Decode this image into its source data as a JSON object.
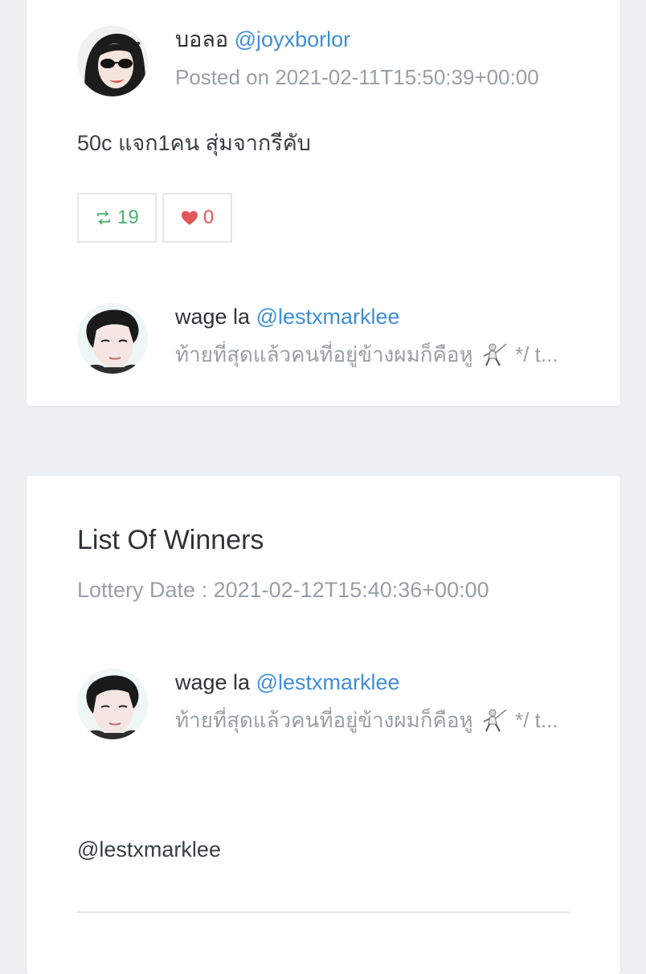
{
  "post": {
    "author": {
      "display_name": "บอลอ",
      "handle": "@joyxborlor",
      "posted_on": "Posted on 2021-02-11T15:50:39+00:00",
      "avatar_icon": "avatar-woman-sunglasses"
    },
    "text": "50c แจก1คน สุ่มจากรีคับ",
    "retweets": "19",
    "likes": "0",
    "retweet_color": "#4caf76",
    "like_color": "#e0575b",
    "participant": {
      "display_name": "wage la",
      "handle": "@lestxmarklee",
      "bio_prefix": "ท้ายที่สุดแล้วคนที่อยู่ข้างผมก็คือหู",
      "bio_suffix": "*/ t...",
      "avatar_icon": "avatar-young-man"
    }
  },
  "winners": {
    "title": "List Of Winners",
    "lottery_date": "Lottery Date : 2021-02-12T15:40:36+00:00",
    "winner": {
      "display_name": "wage la",
      "handle": "@lestxmarklee",
      "bio_prefix": "ท้ายที่สุดแล้วคนที่อยู่ข้างผมก็คือหู",
      "bio_suffix": "*/ t...",
      "avatar_icon": "avatar-young-man"
    },
    "winner_handle_text": "@lestxmarklee"
  },
  "colors": {
    "link": "#3f8fd8",
    "muted": "#9a9fa5",
    "background": "#eef0f3"
  }
}
